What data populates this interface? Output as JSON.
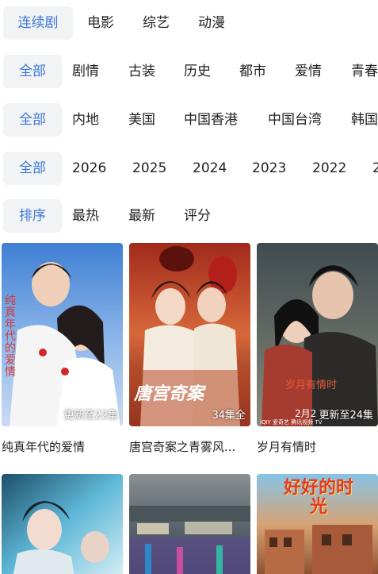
{
  "category_tabs": {
    "active": "连续剧",
    "items": [
      "电影",
      "综艺",
      "动漫"
    ]
  },
  "genre_filter": {
    "active": "全部",
    "items": [
      "剧情",
      "古装",
      "历史",
      "都市",
      "爱情",
      "青春"
    ]
  },
  "region_filter": {
    "active": "全部",
    "items": [
      "内地",
      "美国",
      "中国香港",
      "中国台湾",
      "韩国"
    ]
  },
  "year_filter": {
    "active": "全部",
    "items": [
      "2026",
      "2025",
      "2024",
      "2023",
      "2022",
      "2"
    ]
  },
  "sort_filter": {
    "active": "排序",
    "items": [
      "最热",
      "最新",
      "评分"
    ]
  },
  "cards": [
    {
      "title": "纯真年代的爱情",
      "badge": "更新至22集",
      "poster_text": "纯真年代的爱情"
    },
    {
      "title": "唐宫奇案之青雾风...",
      "badge": "34集全",
      "poster_text": "唐宫奇案"
    },
    {
      "title": "岁月有情时",
      "badge": "更新至24集",
      "poster_text": "岁月有情时",
      "poster_date": "2月2",
      "poster_logo": "iQIY 爱奇艺 腾讯视频 TV"
    }
  ],
  "cards_row2": [
    {
      "poster_text": ""
    },
    {
      "poster_text": ""
    },
    {
      "poster_text": "好好的时光"
    }
  ],
  "colors": {
    "accent": "#3c78d8",
    "pill_bg": "#f2f3f5"
  }
}
